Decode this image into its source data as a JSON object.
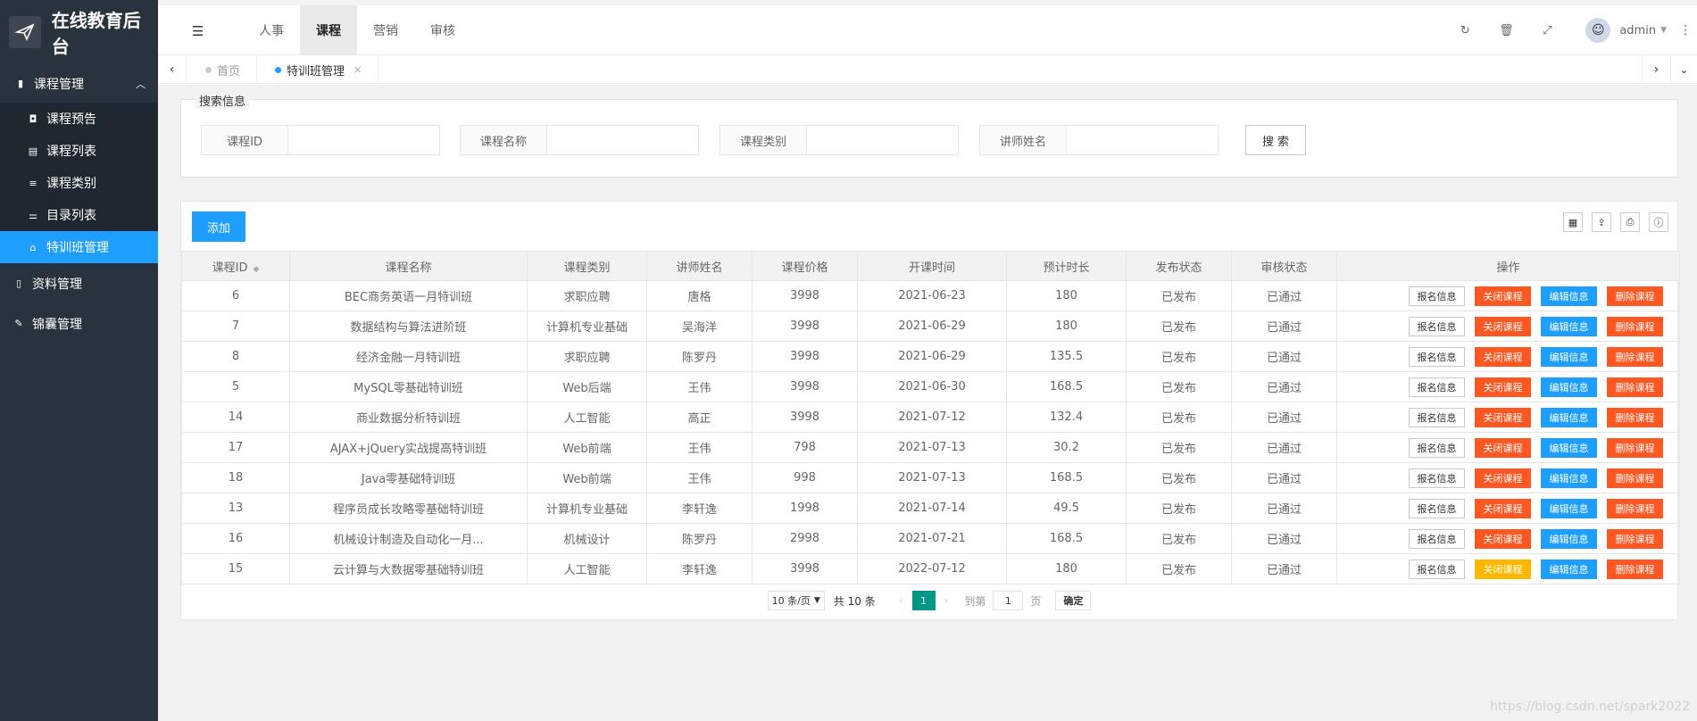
{
  "app": {
    "title": "在线教育后台"
  },
  "sidebar": {
    "group": {
      "label": "课程管理",
      "icon": "book-icon"
    },
    "items": [
      {
        "label": "课程预告",
        "icon": "tag-icon"
      },
      {
        "label": "课程列表",
        "icon": "list-icon"
      },
      {
        "label": "课程类别",
        "icon": "menu-icon"
      },
      {
        "label": "目录列表",
        "icon": "sliders-icon"
      },
      {
        "label": "特训班管理",
        "icon": "bank-icon",
        "active": true
      }
    ],
    "others": [
      {
        "label": "资料管理",
        "icon": "file-icon"
      },
      {
        "label": "锦囊管理",
        "icon": "pencil-icon"
      }
    ]
  },
  "header": {
    "nav": [
      "人事",
      "课程",
      "营销",
      "审核"
    ],
    "active_nav": "课程",
    "user": "admin"
  },
  "tabs": [
    {
      "label": "首页",
      "active": false
    },
    {
      "label": "特训班管理",
      "active": true
    }
  ],
  "search": {
    "legend": "搜索信息",
    "fields": [
      {
        "label": "课程ID",
        "value": ""
      },
      {
        "label": "课程名称",
        "value": ""
      },
      {
        "label": "课程类别",
        "value": ""
      },
      {
        "label": "讲师姓名",
        "value": ""
      }
    ],
    "button": "搜 索"
  },
  "toolbar": {
    "add": "添加"
  },
  "table": {
    "columns": [
      "课程ID",
      "课程名称",
      "课程类别",
      "讲师姓名",
      "课程价格",
      "开课时间",
      "预计时长",
      "发布状态",
      "审核状态",
      "操作"
    ],
    "rows": [
      {
        "id": "6",
        "name": "BEC商务英语一月特训班",
        "category": "求职应聘",
        "teacher": "唐格",
        "price": "3998",
        "date": "2021-06-23",
        "date_red": true,
        "duration": "180",
        "publish": "已发布",
        "audit": "已通过",
        "close_yellow": false
      },
      {
        "id": "7",
        "name": "数据结构与算法进阶班",
        "category": "计算机专业基础",
        "teacher": "吴海洋",
        "price": "3998",
        "date": "2021-06-29",
        "date_red": true,
        "duration": "180",
        "publish": "已发布",
        "audit": "已通过",
        "close_yellow": false
      },
      {
        "id": "8",
        "name": "经济金融一月特训班",
        "category": "求职应聘",
        "teacher": "陈罗丹",
        "price": "3998",
        "date": "2021-06-29",
        "date_red": true,
        "duration": "135.5",
        "publish": "已发布",
        "audit": "已通过",
        "close_yellow": false
      },
      {
        "id": "5",
        "name": "MySQL零基础特训班",
        "category": "Web后端",
        "teacher": "王伟",
        "price": "3998",
        "date": "2021-06-30",
        "date_red": true,
        "duration": "168.5",
        "publish": "已发布",
        "audit": "已通过",
        "close_yellow": false
      },
      {
        "id": "14",
        "name": "商业数据分析特训班",
        "category": "人工智能",
        "teacher": "高正",
        "price": "3998",
        "date": "2021-07-12",
        "date_red": true,
        "duration": "132.4",
        "publish": "已发布",
        "audit": "已通过",
        "close_yellow": false
      },
      {
        "id": "17",
        "name": "AJAX+jQuery实战提高特训班",
        "category": "Web前端",
        "teacher": "王伟",
        "price": "798",
        "date": "2021-07-13",
        "date_red": true,
        "duration": "30.2",
        "publish": "已发布",
        "audit": "已通过",
        "close_yellow": false
      },
      {
        "id": "18",
        "name": "Java零基础特训班",
        "category": "Web前端",
        "teacher": "王伟",
        "price": "998",
        "date": "2021-07-13",
        "date_red": true,
        "duration": "168.5",
        "publish": "已发布",
        "audit": "已通过",
        "close_yellow": false
      },
      {
        "id": "13",
        "name": "程序员成长攻略零基础特训班",
        "category": "计算机专业基础",
        "teacher": "李轩逸",
        "price": "1998",
        "date": "2021-07-14",
        "date_red": true,
        "duration": "49.5",
        "publish": "已发布",
        "audit": "已通过",
        "close_yellow": false
      },
      {
        "id": "16",
        "name": "机械设计制造及自动化一月...",
        "category": "机械设计",
        "teacher": "陈罗丹",
        "price": "2998",
        "date": "2021-07-21",
        "date_red": true,
        "duration": "168.5",
        "publish": "已发布",
        "audit": "已通过",
        "close_yellow": false
      },
      {
        "id": "15",
        "name": "云计算与大数据零基础特训班",
        "category": "人工智能",
        "teacher": "李轩逸",
        "price": "3998",
        "date": "2022-07-12",
        "date_red": false,
        "duration": "180",
        "publish": "已发布",
        "audit": "已通过",
        "close_yellow": true
      }
    ],
    "actions": [
      "报名信息",
      "关闭课程",
      "编辑信息",
      "删除课程"
    ]
  },
  "pager": {
    "page_size": "10 条/页",
    "total": "共 10 条",
    "current": "1",
    "goto_label": "到第",
    "goto_value": "1",
    "page_unit": "页",
    "confirm": "确定"
  },
  "watermark": "https://blog.csdn.net/spark2022"
}
